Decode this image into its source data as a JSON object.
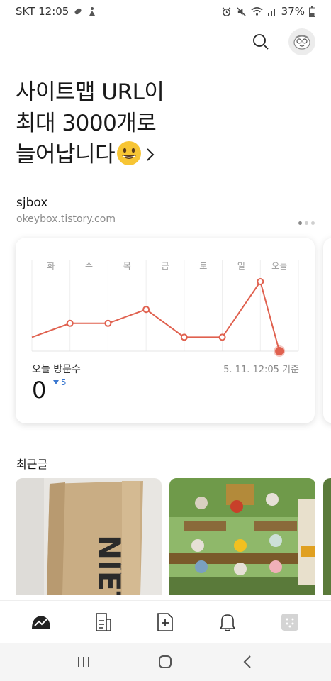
{
  "status_bar": {
    "carrier_time": "SKT 12:05",
    "battery": "37%"
  },
  "headline": {
    "line1": "사이트맵 URL이",
    "line2": "최대 3000개로",
    "line3": "늘어납니다"
  },
  "blog": {
    "name": "sjbox",
    "url": "okeybox.tistory.com"
  },
  "stats": {
    "days": [
      "화",
      "수",
      "목",
      "금",
      "토",
      "일",
      "오늘"
    ],
    "visitors_label": "오늘 방문수",
    "as_of": "5. 11. 12:05 기준",
    "today_count": "0",
    "change": "5",
    "line_color": "#e0614f",
    "chart_data": {
      "type": "line",
      "categories": [
        "(start)",
        "화",
        "수",
        "목",
        "금",
        "토",
        "일",
        "오늘"
      ],
      "values": [
        1,
        2,
        2,
        3,
        1,
        1,
        5,
        0
      ]
    }
  },
  "recent": {
    "title": "최근글"
  },
  "bottom_nav": {
    "items": [
      "stats-icon",
      "posts-icon",
      "new-post-icon",
      "notification-icon",
      "more-icon"
    ]
  }
}
